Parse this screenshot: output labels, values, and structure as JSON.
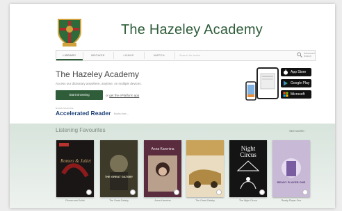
{
  "site": {
    "title": "The Hazeley Academy"
  },
  "nav": {
    "tabs": [
      "LIBRARY",
      "BROWSE",
      "LOANS",
      "WATCH"
    ],
    "search_placeholder": "Search for books",
    "advanced_label": "Advanced Search"
  },
  "hero": {
    "title": "The Hazeley Academy",
    "subtitle": "Access our dictionary anywhere, anytime, on multiple devices.",
    "browse_button": "Start Browsing",
    "app_prefix": "or",
    "app_link": "get the ePlatform app",
    "ar_small": "RENAISSANCE",
    "ar_logo": "Accelerated Reader",
    "ar_sub": "Books from ..."
  },
  "stores": [
    {
      "label": "App Store",
      "icon": "apple-icon"
    },
    {
      "label": "Google Play",
      "icon": "google-play-icon"
    },
    {
      "label": "Microsoft",
      "icon": "microsoft-icon"
    }
  ],
  "listening": {
    "title": "Listening Favourites",
    "see_more": "SEE MORE ›",
    "books": [
      {
        "title": "Romeo and Juliet",
        "cover_text": "Romeo & Juliet",
        "cover_bg": "#1a1616",
        "cover_fg": "#c9a46a"
      },
      {
        "title": "The Great Gatsby",
        "cover_text": "THE GREAT GATSBY",
        "cover_bg": "#3d3a2a",
        "cover_fg": "#e9e2c8"
      },
      {
        "title": "Anna Karenina",
        "cover_text": "Anna Karenina",
        "cover_bg": "#5a2c3e",
        "cover_fg": "#f3e8ec"
      },
      {
        "title": "The Great Gatsby",
        "cover_text": "",
        "cover_bg": "#b08a44",
        "cover_fg": "#fff"
      },
      {
        "title": "The Night Circus",
        "cover_text": "Night Circus",
        "cover_bg": "#141414",
        "cover_fg": "#ffffff"
      },
      {
        "title": "Ready Player One",
        "cover_text": "READY PLAYER ONE",
        "cover_bg": "#c8b9d6",
        "cover_fg": "#5a3d7a"
      }
    ]
  },
  "colors": {
    "brand": "#2f5d3a",
    "band": "#d7e4dc"
  }
}
